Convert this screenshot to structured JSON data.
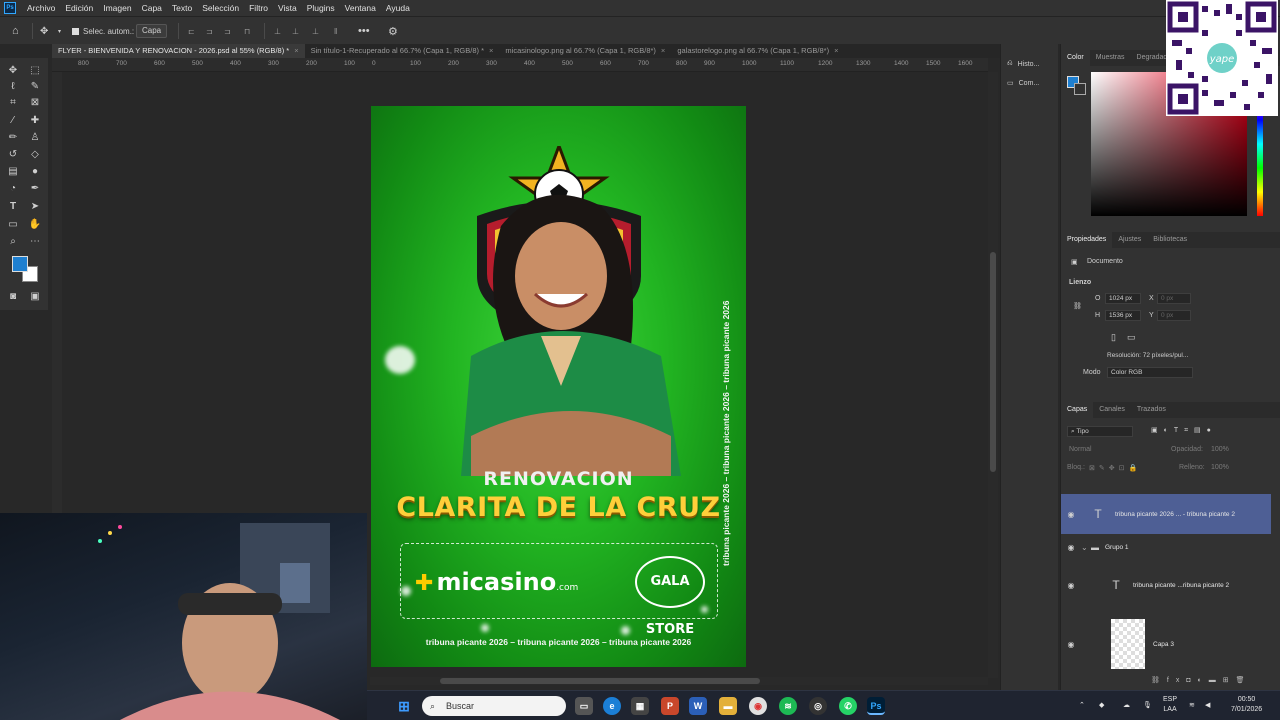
{
  "menu": [
    "Archivo",
    "Edición",
    "Imagen",
    "Capa",
    "Texto",
    "Selección",
    "Filtro",
    "Vista",
    "Plugins",
    "Ventana",
    "Ayuda"
  ],
  "options": {
    "auto_select": "Selec. autom.:",
    "target": "Capa"
  },
  "tabs": [
    {
      "label": "FLYER - BIENVENIDA Y RENOVACION - 2026.psd al 55% (RGB/8) *",
      "active": true
    },
    {
      "label": "Sin título-1-Recuperado al 66.7% (Capa 1, RGB/8) *",
      "active": false
    },
    {
      "label": "micasinologo.png al 66.7% (Capa 1, RGB/8*)",
      "active": false
    },
    {
      "label": "galastorelogo.png al 66.7% (Capa 1, RGB/8*)",
      "active": false
    }
  ],
  "ruler_ticks": [
    "800",
    "700",
    "600",
    "500",
    "400",
    "300",
    "200",
    "100",
    "0",
    "100",
    "200",
    "300",
    "400",
    "500",
    "600",
    "700",
    "800",
    "900",
    "1000",
    "1100",
    "1200",
    "1300",
    "1400",
    "1500",
    "1600"
  ],
  "flyer": {
    "title": "RENOVACION",
    "name": "CLARITA DE LA CRUZ",
    "sponsor1": "micasino",
    "sponsor1_suffix": ".com",
    "sponsor2": "GALA STORE",
    "bottom_text": "tribuna picante 2026 – tribuna picante 2026 – tribuna picante 2026",
    "vertical_text": "tribuna picante 2026 – tribuna picante 2026 – tribuna picante 2026"
  },
  "collapsed_panels": [
    {
      "label": "Histo...",
      "icon": "history-icon"
    },
    {
      "label": "Com...",
      "icon": "comments-icon"
    }
  ],
  "color_panel": {
    "tabs": [
      "Color",
      "Muestras",
      "Degradad"
    ],
    "fg_color": "#1e7fd0",
    "bg_color": "#ffffff"
  },
  "properties": {
    "tabs": [
      "Propiedades",
      "Ajustes",
      "Bibliotecas"
    ],
    "section": "Documento",
    "lienzo": "Lienzo",
    "width_label": "O",
    "width": "1024 px",
    "height_label": "H",
    "height": "1536 px",
    "x_label": "X",
    "x_placeholder": "0 px",
    "y_label": "Y",
    "y_placeholder": "0 px",
    "resolution": "Resolución: 72 píxeles/pul...",
    "mode_label": "Modo",
    "mode": "Color RGB"
  },
  "layers_panel": {
    "tabs": [
      "Capas",
      "Canales",
      "Trazados"
    ],
    "filter": "Tipo",
    "blend": "Normal",
    "opacity_label": "Opacidad:",
    "opacity": "100%",
    "lock_label": "Bloq.:",
    "fill_label": "Relleno:",
    "fill": "100%",
    "layers": [
      {
        "name": "tribuna picante 2026 ... - tribuna picante 2",
        "type": "text",
        "selected": true
      },
      {
        "name": "Grupo 1",
        "type": "group",
        "selected": false
      },
      {
        "name": "tribuna picante ...ribuna picante 2",
        "type": "text",
        "selected": false
      },
      {
        "name": "Capa 3",
        "type": "pixel",
        "selected": false
      }
    ]
  },
  "taskbar": {
    "search": "Buscar",
    "lang": "ESP",
    "lang2": "LAA",
    "time": "00:50",
    "date": "7/01/2026"
  }
}
